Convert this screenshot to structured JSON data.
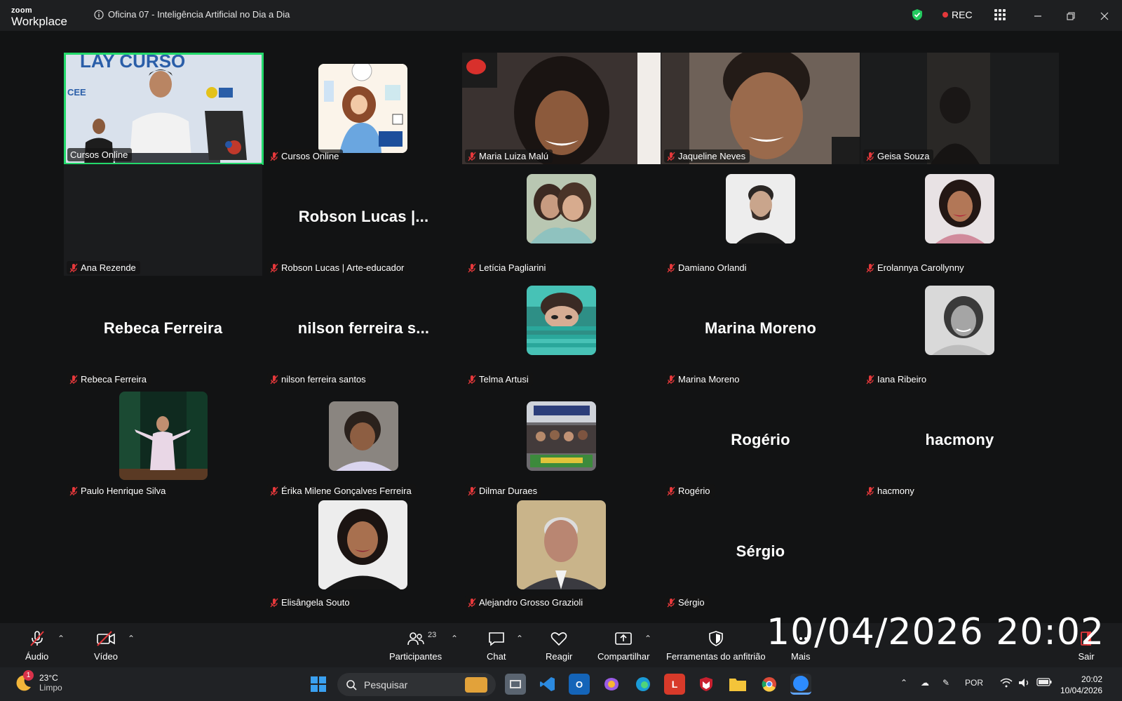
{
  "app": {
    "logo_top": "zoom",
    "logo_bottom": "Workplace",
    "meeting_title": "Oficina 07 - Inteligência Artificial no Dia a Dia",
    "rec_label": "REC"
  },
  "participants": [
    {
      "name": "Cursos Online",
      "big": ""
    },
    {
      "name": "Cursos Online",
      "big": ""
    },
    {
      "name": "Maria Luiza Malú",
      "big": ""
    },
    {
      "name": "Jaqueline Neves",
      "big": ""
    },
    {
      "name": "Geisa Souza",
      "big": ""
    },
    {
      "name": "Ana Rezende",
      "big": ""
    },
    {
      "name": "Robson Lucas | Arte-educador",
      "big": "Robson Lucas |..."
    },
    {
      "name": "Letícia Pagliarini",
      "big": ""
    },
    {
      "name": "Damiano Orlandi",
      "big": ""
    },
    {
      "name": "Erolannya Carollynny",
      "big": ""
    },
    {
      "name": "Rebeca Ferreira",
      "big": "Rebeca Ferreira"
    },
    {
      "name": "nilson ferreira santos",
      "big": "nilson ferreira s..."
    },
    {
      "name": "Telma Artusi",
      "big": ""
    },
    {
      "name": "Marina Moreno",
      "big": "Marina Moreno"
    },
    {
      "name": "Iana Ribeiro",
      "big": ""
    },
    {
      "name": "Paulo Henrique Silva",
      "big": ""
    },
    {
      "name": "Érika Milene Gonçalves Ferreira",
      "big": ""
    },
    {
      "name": "Dilmar Duraes",
      "big": ""
    },
    {
      "name": "Rogério",
      "big": "Rogério"
    },
    {
      "name": "hacmony",
      "big": "hacmony"
    },
    {
      "name": "Elisângela Souto",
      "big": ""
    },
    {
      "name": "Alejandro Grosso Grazioli",
      "big": ""
    },
    {
      "name": "Sérgio",
      "big": "Sérgio"
    }
  ],
  "toolbar": {
    "audio": "Áudio",
    "video": "Vídeo",
    "participants": "Participantes",
    "participants_count": "23",
    "chat": "Chat",
    "react": "Reagir",
    "share": "Compartilhar",
    "host_tools": "Ferramentas do anfitrião",
    "more": "Mais",
    "leave": "Sair"
  },
  "overlay_timestamp": "10/04/2026 20:02",
  "taskbar": {
    "weather_temp": "23°C",
    "weather_desc": "Limpo",
    "weather_badge": "1",
    "search_placeholder": "Pesquisar",
    "language": "POR",
    "time": "20:02",
    "date": "10/04/2026"
  },
  "colors": {
    "active_speaker": "#23d96b",
    "rec_dot": "#e5383b",
    "muted_mic": "#e5383b",
    "background": "#121314"
  }
}
